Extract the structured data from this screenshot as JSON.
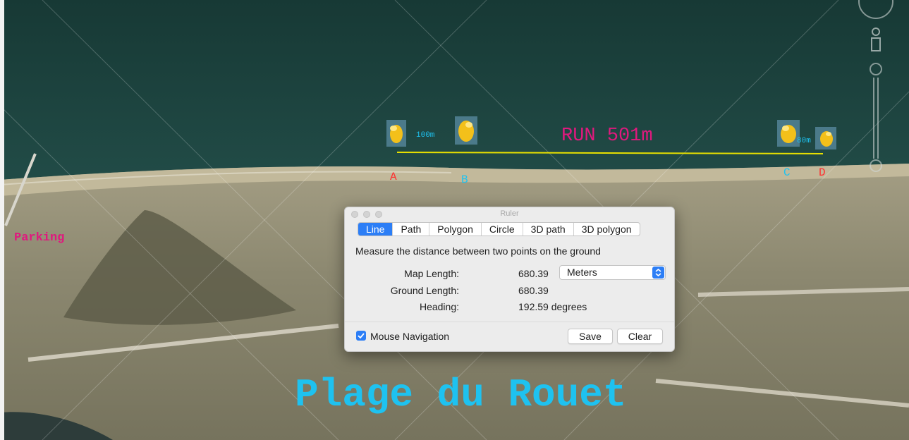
{
  "map": {
    "title": "RUN 501m",
    "place_name": "Plage du Rouet",
    "parking_label": "Parking",
    "dist_ab": "100m",
    "dist_cd": "80m",
    "points": {
      "a": "A",
      "b": "B",
      "c": "C",
      "d": "D"
    },
    "colors": {
      "title": "#e0197e",
      "place": "#1ec2f0",
      "points_red": "#ff3030",
      "points_blue": "#1ec2f0",
      "track": "#e8e000"
    }
  },
  "dialog": {
    "title": "Ruler",
    "tabs": [
      "Line",
      "Path",
      "Polygon",
      "Circle",
      "3D path",
      "3D polygon"
    ],
    "active_tab": "Line",
    "description": "Measure the distance between two points on the ground",
    "map_length_label": "Map Length:",
    "map_length_value": "680.39",
    "unit": "Meters",
    "ground_length_label": "Ground Length:",
    "ground_length_value": "680.39",
    "heading_label": "Heading:",
    "heading_value": "192.59 degrees",
    "mouse_navigation_label": "Mouse Navigation",
    "mouse_navigation_checked": true,
    "save_label": "Save",
    "clear_label": "Clear"
  }
}
